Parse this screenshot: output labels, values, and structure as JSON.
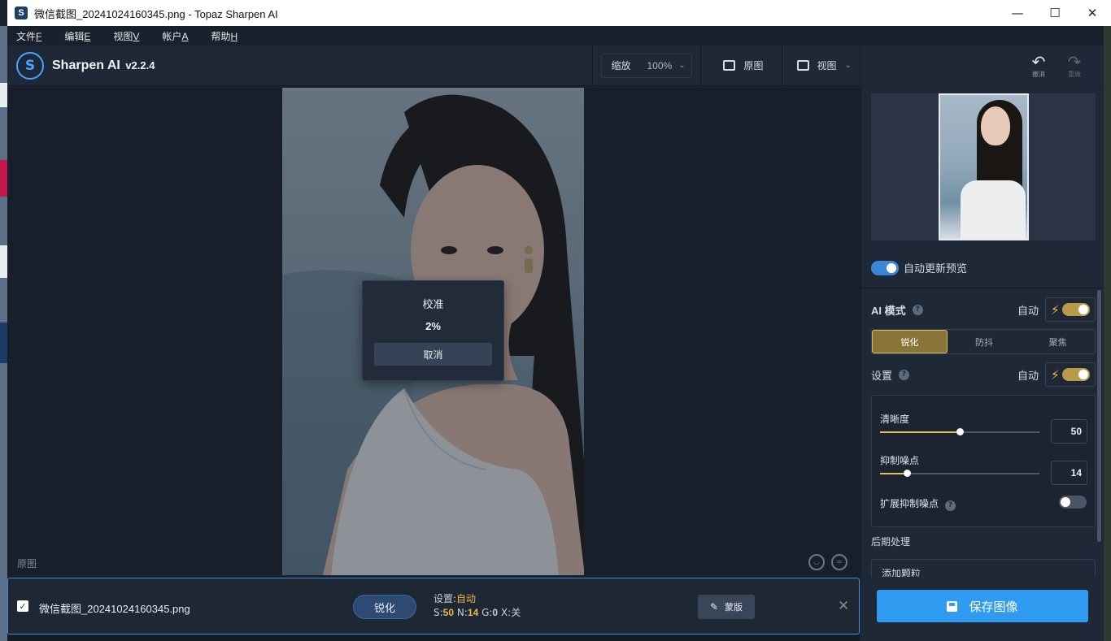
{
  "window": {
    "title": "微信截图_20241024160345.png - Topaz Sharpen AI",
    "minimize": "—",
    "maximize": "☐",
    "close": "✕"
  },
  "menu": [
    {
      "label": "文件",
      "key": "F"
    },
    {
      "label": "编辑",
      "key": "E"
    },
    {
      "label": "视图",
      "key": "V"
    },
    {
      "label": "帐户",
      "key": "A"
    },
    {
      "label": "帮助",
      "key": "H"
    }
  ],
  "toolbar": {
    "brand": "Sharpen AI",
    "version": "v2.2.4",
    "zoom_label": "缩放",
    "zoom_value": "100%",
    "original_label": "原图",
    "view_label": "视图"
  },
  "history": {
    "undo_label": "撤消",
    "redo_label": "重做"
  },
  "canvas": {
    "label": "原图"
  },
  "progress_dialog": {
    "title": "校准",
    "percent": "2%",
    "cancel_label": "取消"
  },
  "panel": {
    "auto_preview_label": "自动更新预览",
    "ai_mode_label": "AI 模式",
    "auto_label": "自动",
    "modes": [
      "锐化",
      "防抖",
      "聚焦"
    ],
    "active_mode": "锐化",
    "settings_label": "设置",
    "settings_auto_label": "自动",
    "sliders": [
      {
        "label": "清晰度",
        "value": "50",
        "fraction": 0.5
      },
      {
        "label": "抑制噪点",
        "value": "14",
        "fraction": 0.17
      }
    ],
    "extended_noise_label": "扩展抑制噪点",
    "post_processing_label": "后期处理",
    "add_grain_label": "添加颗粒"
  },
  "file_item": {
    "filename": "微信截图_20241024160345.png",
    "mode_pill": "锐化",
    "settings_prefix": "设置:",
    "settings_value": "自动",
    "s_label": "S:",
    "s_value": "50",
    "n_label": "N:",
    "n_value": "14",
    "g_label": "G:",
    "g_value": "0",
    "x_label": "X:",
    "x_value": "关",
    "mask_label": "蒙版"
  },
  "save_button_label": "保存图像",
  "colors": {
    "accent_blue": "#2f9cf1",
    "accent_gold": "#e1be5a",
    "panel_bg": "#1f2836"
  }
}
